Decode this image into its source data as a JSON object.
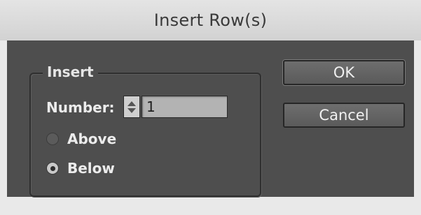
{
  "window": {
    "title": "Insert Row(s)"
  },
  "insert_group": {
    "legend": "Insert",
    "number_label": "Number:",
    "number_value": "1",
    "position_options": [
      {
        "label": "Above",
        "selected": false
      },
      {
        "label": "Below",
        "selected": true
      }
    ]
  },
  "buttons": {
    "ok_label": "OK",
    "cancel_label": "Cancel"
  },
  "icons": {
    "stepper": "up-down-stepper-icon",
    "radio_unselected": "radio-unselected-icon",
    "radio_selected": "radio-selected-icon"
  },
  "colors": {
    "dialog_body": "#4e4e4e",
    "titlebar": "#dcdcdc",
    "text": "#ececec",
    "button": "#646464",
    "input": "#b3b3b3"
  }
}
